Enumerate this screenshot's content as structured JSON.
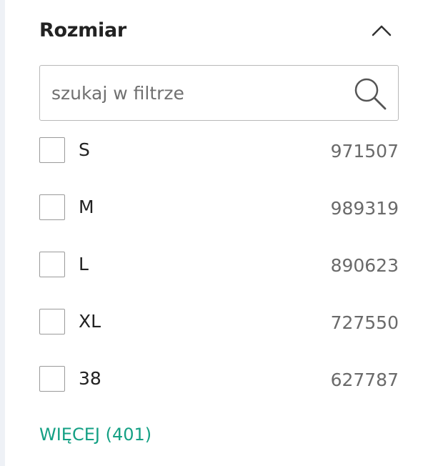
{
  "filter": {
    "title": "Rozmiar",
    "search_placeholder": "szukaj w filtrze",
    "options": [
      {
        "label": "S",
        "count": "971507",
        "checked": false
      },
      {
        "label": "M",
        "count": "989319",
        "checked": false
      },
      {
        "label": "L",
        "count": "890623",
        "checked": false
      },
      {
        "label": "XL",
        "count": "727550",
        "checked": false
      },
      {
        "label": "38",
        "count": "627787",
        "checked": false
      }
    ],
    "more_label": "WIĘCEJ (401)",
    "expanded": true
  },
  "icons": {
    "collapse": "chevron-up-icon",
    "search": "search-icon"
  },
  "colors": {
    "accent_link": "#14a084",
    "count_text": "#6a6a6a",
    "border": "#b8b8b8",
    "rail": "#eef1f6"
  }
}
